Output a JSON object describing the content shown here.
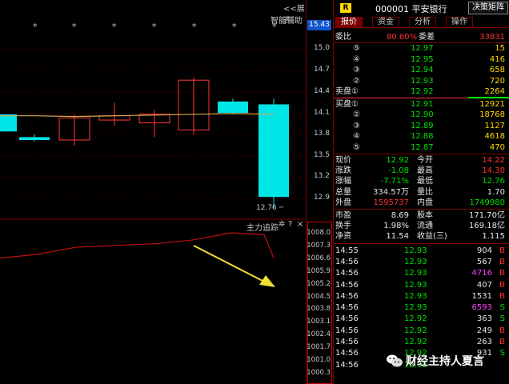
{
  "chart": {
    "expand_label": "<<展开",
    "assist_label": "智能辅助",
    "stars": [
      "*",
      "*",
      "*",
      "*",
      "*",
      "*",
      "*"
    ],
    "low_label": "12.76",
    "indicator_title": "主力追踪",
    "indicator_controls": [
      "✲",
      "?",
      "×"
    ],
    "colors": {
      "up": "#ff3a3a",
      "down": "#00e6e6",
      "ma": "#d4a850",
      "indicator": "#c01010",
      "arrow": "#f0e030"
    }
  },
  "chart_data": {
    "type": "candlestick",
    "candles": [
      {
        "open": 14.08,
        "close": 13.84,
        "high": 14.08,
        "low": 13.84
      },
      {
        "open": 13.76,
        "close": 13.72,
        "high": 13.8,
        "low": 13.7
      },
      {
        "open": 13.72,
        "close": 14.03,
        "high": 14.08,
        "low": 13.64
      },
      {
        "open": 14.0,
        "close": 14.06,
        "high": 14.24,
        "low": 13.92
      },
      {
        "open": 13.96,
        "close": 14.08,
        "high": 14.14,
        "low": 13.76
      },
      {
        "open": 13.86,
        "close": 14.56,
        "high": 14.6,
        "low": 13.8
      },
      {
        "open": 14.26,
        "close": 14.1,
        "high": 14.3,
        "low": 14.08
      },
      {
        "open": 14.22,
        "close": 12.92,
        "high": 14.3,
        "low": 12.76
      }
    ],
    "ma_line": [
      14.06,
      14.06,
      14.05,
      14.06,
      14.07,
      14.08,
      14.09,
      14.08
    ],
    "indicator": [
      1006.6,
      1006.8,
      1007.2,
      1007.3,
      1007.4,
      1007.6,
      1008.0,
      1007.9,
      1006.6
    ],
    "price_ylim": [
      12.9,
      15.0
    ],
    "indicator_ylim": [
      1000.3,
      1008.0
    ]
  },
  "scale": {
    "current_price": "15.43",
    "price_ticks": [
      "15.0",
      "14.7",
      "14.4",
      "14.1",
      "13.8",
      "13.5",
      "13.2",
      "12.9"
    ],
    "indicator_ticks": [
      "1008.0",
      "1007.3",
      "1006.6",
      "1005.9",
      "1005.2",
      "1004.5",
      "1003.8",
      "1003.1",
      "1002.4",
      "1001.7",
      "1001.0",
      "1000.3"
    ]
  },
  "panel": {
    "badge": "R",
    "title": "000001  平安银行",
    "decision_button": "决策矩阵",
    "tabs": [
      "报价",
      "资金",
      "分析",
      "操作"
    ],
    "weibi": {
      "label": "委比",
      "value": "80.60%",
      "label2": "委差",
      "value2": "33831"
    },
    "sell": [
      {
        "label": "⑤",
        "price": "12.97",
        "vol": "15"
      },
      {
        "label": "④",
        "price": "12.95",
        "vol": "416"
      },
      {
        "label": "③",
        "price": "12.94",
        "vol": "658"
      },
      {
        "label": "②",
        "price": "12.93",
        "vol": "720"
      },
      {
        "label": "卖盘①",
        "price": "12.92",
        "vol": "2264"
      }
    ],
    "buy": [
      {
        "label": "买盘①",
        "price": "12.91",
        "vol": "12921"
      },
      {
        "label": "②",
        "price": "12.90",
        "vol": "18768"
      },
      {
        "label": "③",
        "price": "12.89",
        "vol": "1127"
      },
      {
        "label": "④",
        "price": "12.88",
        "vol": "4618"
      },
      {
        "label": "⑤",
        "price": "12.87",
        "vol": "470"
      }
    ],
    "stats": [
      {
        "l1": "现价",
        "v1": "12.92",
        "l2": "今开",
        "v2": "14.22",
        "c1": "green",
        "c2": "red"
      },
      {
        "l1": "涨跌",
        "v1": "-1.08",
        "l2": "最高",
        "v2": "14.30",
        "c1": "green",
        "c2": "red"
      },
      {
        "l1": "涨幅",
        "v1": "-7.71%",
        "l2": "最低",
        "v2": "12.76",
        "c1": "green",
        "c2": "green"
      },
      {
        "l1": "总量",
        "v1": "334.57万",
        "l2": "量比",
        "v2": "1.70",
        "c1": "white",
        "c2": "white"
      },
      {
        "l1": "外盘",
        "v1": "1595737",
        "l2": "内盘",
        "v2": "1749980",
        "c1": "red",
        "c2": "green"
      }
    ],
    "fund": [
      {
        "l1": "市盈",
        "v1": "8.69",
        "l2": "股本",
        "v2": "171.70亿"
      },
      {
        "l1": "换手",
        "v1": "1.98%",
        "l2": "流通",
        "v2": "169.18亿"
      },
      {
        "l1": "净资",
        "v1": "11.54",
        "l2": "收益(三)",
        "v2": "1.115"
      }
    ],
    "ticks": [
      {
        "time": "14:55",
        "price": "12.93",
        "vol": "904",
        "bs": "B",
        "vc": "white",
        "bc": "red"
      },
      {
        "time": "14:56",
        "price": "12.93",
        "vol": "567",
        "bs": "B",
        "vc": "white",
        "bc": "red"
      },
      {
        "time": "14:56",
        "price": "12.93",
        "vol": "4716",
        "bs": "B",
        "vc": "magenta",
        "bc": "red"
      },
      {
        "time": "14:56",
        "price": "12.93",
        "vol": "407",
        "bs": "B",
        "vc": "white",
        "bc": "red"
      },
      {
        "time": "14:56",
        "price": "12.93",
        "vol": "1531",
        "bs": "B",
        "vc": "white",
        "bc": "red"
      },
      {
        "time": "14:56",
        "price": "12.93",
        "vol": "6593",
        "bs": "S",
        "vc": "magenta",
        "bc": "green"
      },
      {
        "time": "14:56",
        "price": "12.92",
        "vol": "363",
        "bs": "S",
        "vc": "white",
        "bc": "green"
      },
      {
        "time": "14:56",
        "price": "12.92",
        "vol": "249",
        "bs": "B",
        "vc": "white",
        "bc": "red"
      },
      {
        "time": "14:56",
        "price": "12.92",
        "vol": "263",
        "bs": "B",
        "vc": "white",
        "bc": "red"
      },
      {
        "time": "14:56",
        "price": "12.92",
        "vol": "931",
        "bs": "S",
        "vc": "white",
        "bc": "green"
      },
      {
        "time": "14:56",
        "price": "12.93",
        "vol": "",
        "bs": "",
        "vc": "white",
        "bc": "red"
      }
    ]
  },
  "watermark": "财经主持人夏言"
}
